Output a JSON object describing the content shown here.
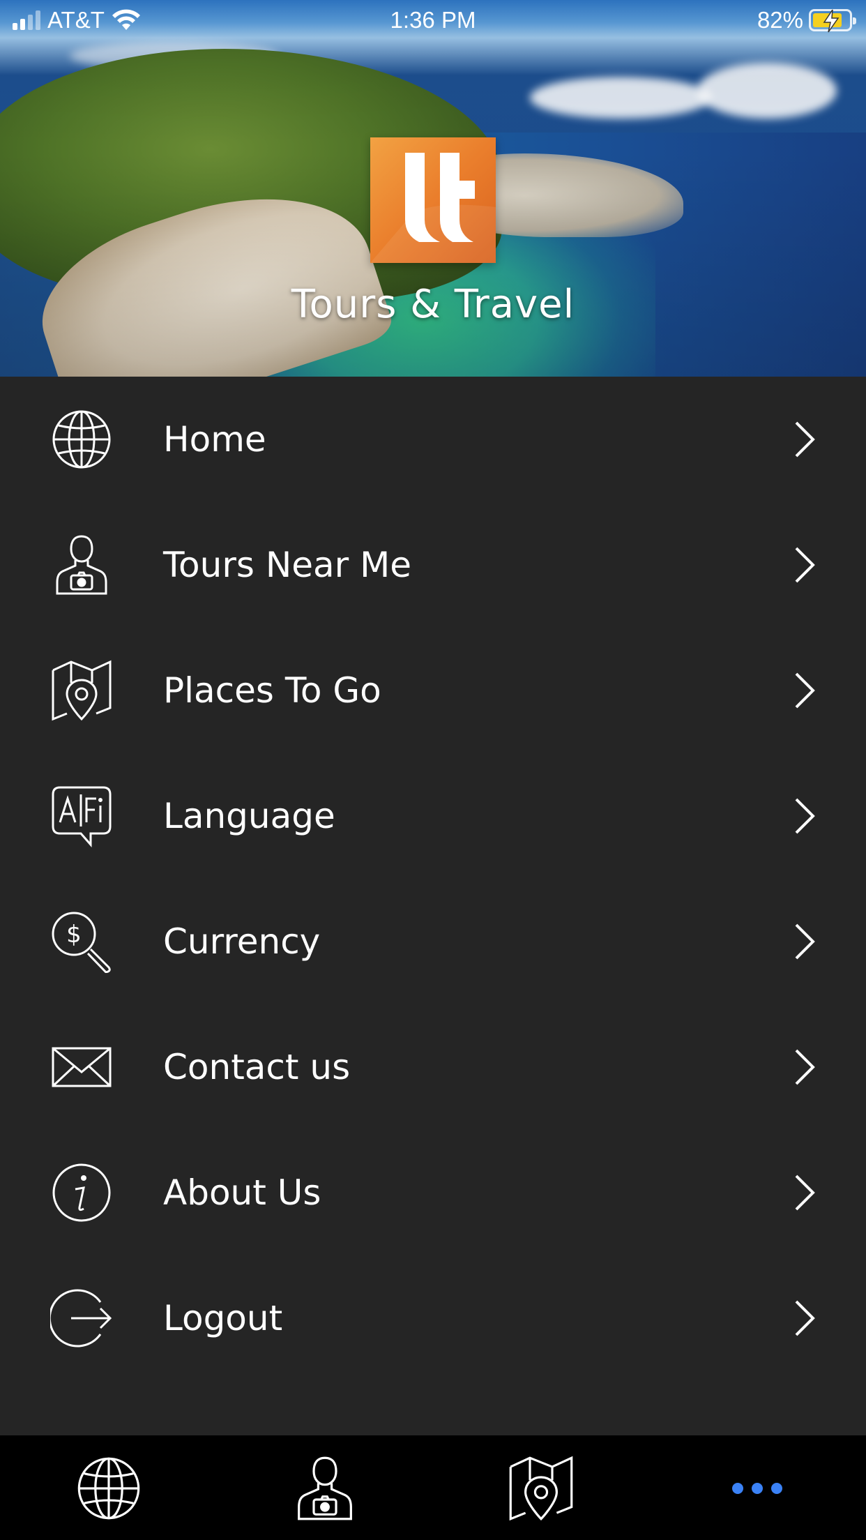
{
  "status_bar": {
    "carrier": "AT&T",
    "time": "1:36 PM",
    "battery": "82%",
    "battery_level": 0.82,
    "signal_bars": 2,
    "icons": [
      "signal-icon",
      "wifi-icon",
      "battery-charging-icon"
    ]
  },
  "header": {
    "brand_title": "Tours & Travel",
    "logo_icon": "tt-logo",
    "accent_color": "#ea7e2c"
  },
  "menu": {
    "items": [
      {
        "label": "Home",
        "icon": "globe-icon"
      },
      {
        "label": "Tours Near Me",
        "icon": "tour-guide-camera-icon"
      },
      {
        "label": "Places To Go",
        "icon": "map-pin-icon"
      },
      {
        "label": "Language",
        "icon": "translate-bubble-icon"
      },
      {
        "label": "Currency",
        "icon": "dollar-search-icon"
      },
      {
        "label": "Contact us",
        "icon": "envelope-icon"
      },
      {
        "label": "About Us",
        "icon": "info-icon"
      },
      {
        "label": "Logout",
        "icon": "logout-icon"
      }
    ],
    "chevron_icon": "chevron-right-icon"
  },
  "tab_bar": {
    "tabs": [
      {
        "icon": "globe-icon",
        "active": false
      },
      {
        "icon": "tour-guide-camera-icon",
        "active": false
      },
      {
        "icon": "map-pin-icon",
        "active": false
      },
      {
        "icon": "more-dots-icon",
        "active": true
      }
    ],
    "active_color": "#3b82f6",
    "inactive_color": "#ffffff"
  }
}
